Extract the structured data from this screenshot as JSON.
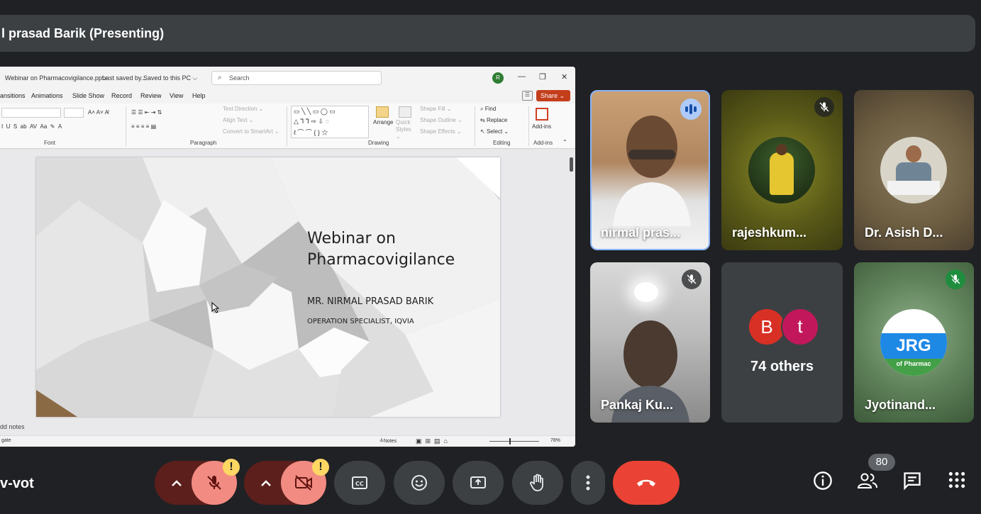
{
  "meeting": {
    "presenter_banner": "l prasad Barik (Presenting)",
    "meeting_code_partial": "v-vot",
    "participant_count": "80",
    "others_count_label": "74 others",
    "colors": {
      "bg": "#202124",
      "end_call": "#ea4335",
      "muted_ctrl": "#f28b82",
      "warning": "#fdd663"
    }
  },
  "powerpoint": {
    "title": "Webinar on Pharmacovigilance.pptx",
    "saved_status": "Last saved by...",
    "saved_location": "Saved to this PC ⌵",
    "search_placeholder": "Search",
    "account_initial": "R",
    "menu": [
      "ansitions",
      "Animations",
      "Slide Show",
      "Record",
      "Review",
      "View",
      "Help"
    ],
    "share_label": "Share ⌄",
    "ribbon": {
      "groups": [
        "Font",
        "Paragraph",
        "Drawing",
        "Editing",
        "Add-ins"
      ],
      "paragraph_items": [
        "Text Direction ⌄",
        "Align Text ⌄",
        "Convert to SmartArt ⌄"
      ],
      "drawing_items": [
        "Arrange",
        "Quick Styles ⌄",
        "Shape Fill ⌄",
        "Shape Outline ⌄",
        "Shape Effects ⌄"
      ],
      "editing_items": [
        "Find",
        "Replace",
        "Select ⌄"
      ],
      "addins_label": "Add-ins"
    },
    "slide": {
      "title_line1": "Webinar on",
      "title_line2": "Pharmacovigilance",
      "presenter": "MR. NIRMAL PRASAD BARIK",
      "role": "OPERATION SPECIALIST, IQVIA"
    },
    "notes_hint": "dd notes",
    "status_left": "gate",
    "status_notes": "Notes",
    "zoom": "78%"
  },
  "participants": [
    {
      "name": "nirmal pras...",
      "speaking": true
    },
    {
      "name": "rajeshkum...",
      "muted": true
    },
    {
      "name": "Dr. Asish D..."
    },
    {
      "name": "Pankaj Ku...",
      "muted": true
    },
    {
      "name": "74 others",
      "avatars": [
        "B",
        "t"
      ]
    },
    {
      "name": "Jyotinand...",
      "muted": true,
      "logo_text": "JRG",
      "logo_sub": "of Pharmac"
    }
  ]
}
